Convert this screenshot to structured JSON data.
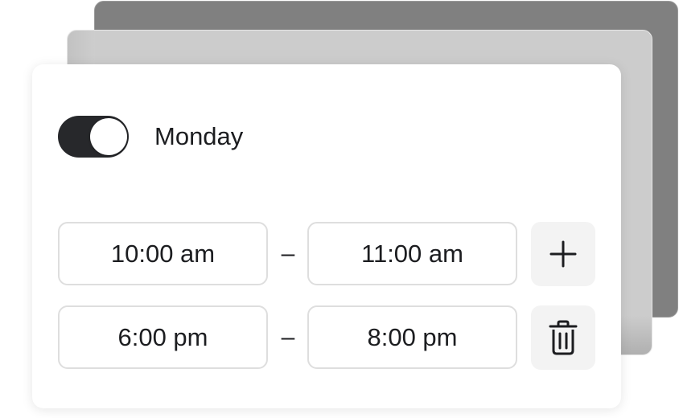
{
  "schedule": {
    "day": {
      "label": "Monday",
      "enabled": true
    },
    "separator": "–",
    "slots": [
      {
        "start": "10:00 am",
        "end": "11:00 am",
        "action_icon": "plus-icon"
      },
      {
        "start": "6:00 pm",
        "end": "8:00 pm",
        "action_icon": "trash-icon"
      }
    ]
  },
  "colors": {
    "toggle_on": "#27282b",
    "text": "#1c1d20",
    "field_border": "#dedede",
    "icon_button_bg": "#f3f3f3"
  }
}
